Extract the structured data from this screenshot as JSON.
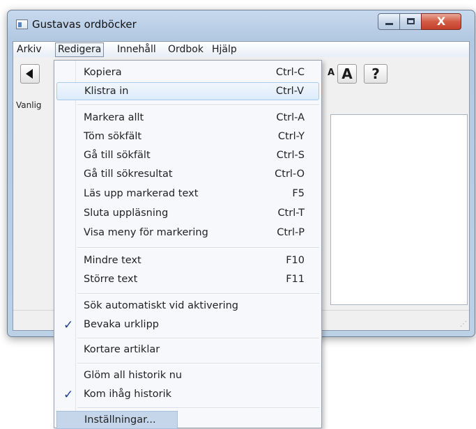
{
  "window": {
    "title": "Gustavas ordböcker",
    "close_label": "X"
  },
  "menubar": {
    "items": [
      "Arkiv",
      "Redigera",
      "Innehåll",
      "Ordbok",
      "Hjälp"
    ]
  },
  "toolbar": {
    "font_small_label": "A",
    "font_large_label": "A",
    "help_label": "?",
    "icons": [
      "back-arrow-icon"
    ]
  },
  "sidebar": {
    "label": "Vanlig"
  },
  "dropdown": {
    "items": [
      {
        "label": "Kopiera",
        "shortcut": "Ctrl-C"
      },
      {
        "label": "Klistra in",
        "shortcut": "Ctrl-V"
      },
      {
        "label": "Markera allt",
        "shortcut": "Ctrl-A"
      },
      {
        "label": "Töm sökfält",
        "shortcut": "Ctrl-Y"
      },
      {
        "label": "Gå till sökfält",
        "shortcut": "Ctrl-S"
      },
      {
        "label": "Gå till sökresultat",
        "shortcut": "Ctrl-O"
      },
      {
        "label": "Läs upp markerad text",
        "shortcut": "F5"
      },
      {
        "label": "Sluta uppläsning",
        "shortcut": "Ctrl-T"
      },
      {
        "label": "Visa meny för markering",
        "shortcut": "Ctrl-P"
      },
      {
        "label": "Mindre text",
        "shortcut": "F10"
      },
      {
        "label": "Större text",
        "shortcut": "F11"
      },
      {
        "label": "Sök automatiskt vid aktivering"
      },
      {
        "label": "Bevaka urklipp",
        "checked": true,
        "check": "✓"
      },
      {
        "label": "Kortare artiklar"
      },
      {
        "label": "Glöm all historik nu"
      },
      {
        "label": "Kom ihåg historik",
        "checked": true,
        "check": "✓"
      },
      {
        "label": "Inställningar..."
      }
    ]
  },
  "colors": {
    "titlebar": "#b3c9e2",
    "close_button": "#d35b45",
    "hover": "#dcebfb",
    "checkmark": "#1b3f8f"
  }
}
